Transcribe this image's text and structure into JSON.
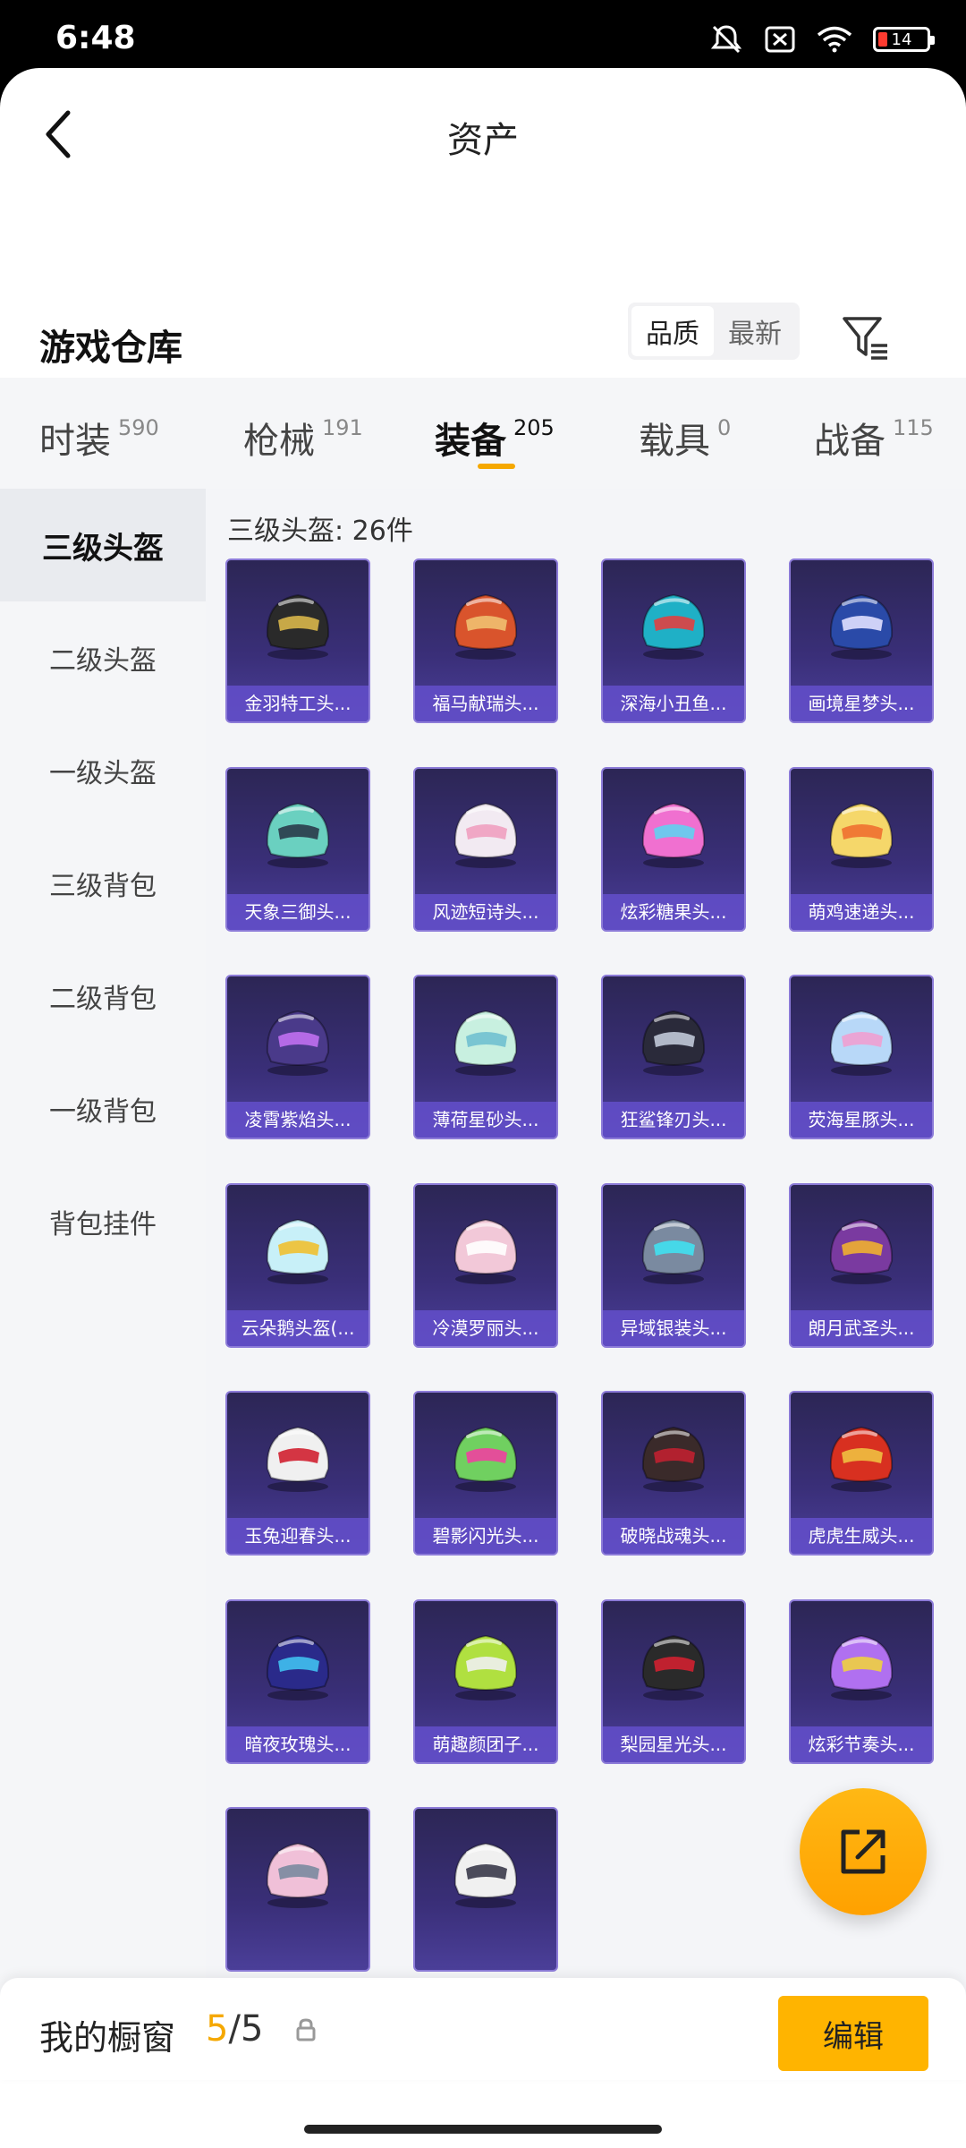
{
  "status_bar": {
    "time": "6:48",
    "battery": "14"
  },
  "header": {
    "title": "资产"
  },
  "warehouse": {
    "title": "游戏仓库",
    "sort_options": [
      "品质",
      "最新"
    ],
    "active_sort": "品质"
  },
  "categories": [
    {
      "label": "时装",
      "count": "590"
    },
    {
      "label": "枪械",
      "count": "191"
    },
    {
      "label": "装备",
      "count": "205"
    },
    {
      "label": "载具",
      "count": "0"
    },
    {
      "label": "战备",
      "count": "115"
    }
  ],
  "active_category": "装备",
  "sidebar": {
    "items": [
      "三级头盔",
      "二级头盔",
      "一级头盔",
      "三级背包",
      "二级背包",
      "一级背包",
      "背包挂件"
    ],
    "active": "三级头盔"
  },
  "content": {
    "count_label": "三级头盔: 26件",
    "items": [
      {
        "name": "金羽特工头...",
        "color": "#2a2a2a",
        "accent": "#d8b64a"
      },
      {
        "name": "福马献瑞头...",
        "color": "#d9542c",
        "accent": "#f0c070"
      },
      {
        "name": "深海小丑鱼...",
        "color": "#1fb0c6",
        "accent": "#e04040"
      },
      {
        "name": "画境星梦头...",
        "color": "#2a4aa8",
        "accent": "#e0e0ff"
      },
      {
        "name": "天象三御头...",
        "color": "#6ad0c0",
        "accent": "#2a3a4a"
      },
      {
        "name": "风迹短诗头...",
        "color": "#f2eaf2",
        "accent": "#f0a0c0"
      },
      {
        "name": "炫彩糖果头...",
        "color": "#f070d0",
        "accent": "#60d0f0"
      },
      {
        "name": "萌鸡速递头...",
        "color": "#f5d76a",
        "accent": "#f07030"
      },
      {
        "name": "凌霄紫焰头...",
        "color": "#4a3a8a",
        "accent": "#c070f0"
      },
      {
        "name": "薄荷星砂头...",
        "color": "#c8f0e0",
        "accent": "#70c0d0"
      },
      {
        "name": "狂鲨锋刃头...",
        "color": "#2a2a3a",
        "accent": "#c0c8d8"
      },
      {
        "name": "荧海星豚头...",
        "color": "#b8d8f8",
        "accent": "#f0a0d0"
      },
      {
        "name": "云朵鹅头盔(...",
        "color": "#c8f0f8",
        "accent": "#f0c030"
      },
      {
        "name": "冷漠罗丽头...",
        "color": "#f2c8d8",
        "accent": "#ffffff"
      },
      {
        "name": "异域银装头...",
        "color": "#7a8aa0",
        "accent": "#40e0f0"
      },
      {
        "name": "朗月武圣头...",
        "color": "#7a3aa0",
        "accent": "#f0b030"
      },
      {
        "name": "玉兔迎春头...",
        "color": "#f0f0f0",
        "accent": "#d02030"
      },
      {
        "name": "碧影闪光头...",
        "color": "#70d060",
        "accent": "#f040a0"
      },
      {
        "name": "破晓战魂头...",
        "color": "#3a2a2a",
        "accent": "#c02030"
      },
      {
        "name": "虎虎生威头...",
        "color": "#d83020",
        "accent": "#f0c040"
      },
      {
        "name": "暗夜玫瑰头...",
        "color": "#2a2a8a",
        "accent": "#40c0f0"
      },
      {
        "name": "萌趣颜团子...",
        "color": "#b0e040",
        "accent": "#f0f0f0"
      },
      {
        "name": "梨园星光头...",
        "color": "#2a2a2a",
        "accent": "#d02030"
      },
      {
        "name": "炫彩节奏头...",
        "color": "#b070f0",
        "accent": "#f0d040"
      },
      {
        "name": "",
        "color": "#f0c0d8",
        "accent": "#7a8aa0"
      },
      {
        "name": "",
        "color": "#f0f0f0",
        "accent": "#3a3a4a"
      }
    ]
  },
  "bottom_bar": {
    "label": "我的橱窗",
    "current": "5",
    "separator": "/",
    "max": "5",
    "edit_label": "编辑"
  },
  "icons": {
    "back": "back-arrow-icon",
    "filter": "filter-icon",
    "share": "share-external-icon",
    "lock": "lock-icon"
  }
}
